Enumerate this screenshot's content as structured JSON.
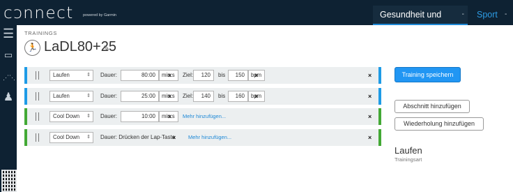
{
  "header": {
    "logo": "cɔnnect",
    "logo_sub": "powered by Garmin",
    "tabs": [
      {
        "label": "Gesundheit und Fitness",
        "dropdown": "-"
      },
      {
        "label": "Sport",
        "dropdown": "-"
      }
    ]
  },
  "sidebar": {
    "icons": [
      "menu-icon",
      "inbox-icon",
      "link-icon",
      "person-icon",
      "qr-code-icon"
    ]
  },
  "workout": {
    "section_label": "TRAININGS",
    "title": "LaDL80+25",
    "type_icon": "runner-icon"
  },
  "steps": [
    {
      "type": "Laufen",
      "duration_label": "Dauer:",
      "duration": "80:00",
      "unit": "min:s",
      "target_label": "Ziel:",
      "target_from": "120",
      "between": "bis",
      "target_to": "150",
      "target_unit": "bpm",
      "close": "×",
      "remove": "×"
    },
    {
      "type": "Laufen",
      "duration_label": "Dauer:",
      "duration": "25:00",
      "unit": "min:s",
      "target_label": "Ziel:",
      "target_from": "140",
      "between": "bis",
      "target_to": "160",
      "target_unit": "bpm",
      "close": "×",
      "remove": "×"
    },
    {
      "type": "Cool Down",
      "duration_label": "Dauer:",
      "duration": "10:00",
      "unit": "min:s",
      "more": "Mehr hinzufügen...",
      "close": "×",
      "remove": "×"
    },
    {
      "type": "Cool Down",
      "duration_text": "Dauer: Drücken der Lap-Taste",
      "more": "Mehr hinzufügen...",
      "close": "×",
      "remove": "×"
    }
  ],
  "actions": {
    "save": "Training speichern",
    "add_step": "Abschnitt hinzufügen",
    "add_repeat": "Wiederholung hinzufügen"
  },
  "summary": {
    "sport": "Laufen",
    "sport_label": "Trainingsart"
  },
  "colors": {
    "primary": "#2196f3",
    "step_active": "#1e9be6",
    "step_cooldown": "#43a935",
    "nav": "#0e2233"
  }
}
